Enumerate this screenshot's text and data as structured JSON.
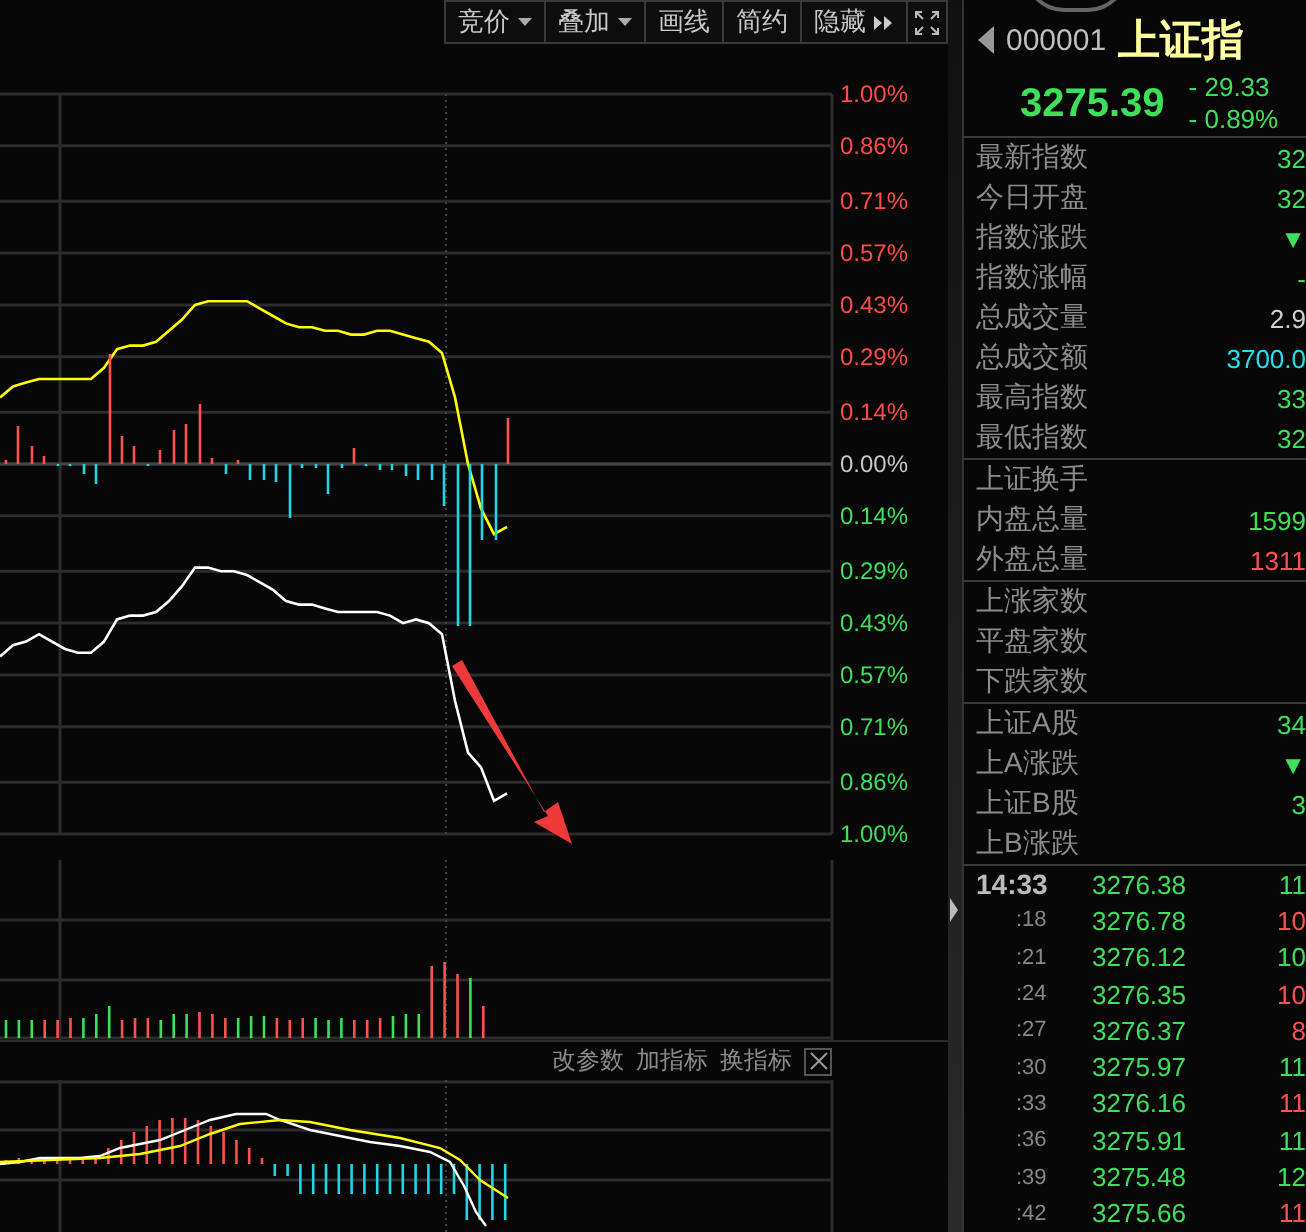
{
  "toolbar": [
    {
      "label": "竞价",
      "kind": "dropdown"
    },
    {
      "label": "叠加",
      "kind": "dropdown"
    },
    {
      "label": "画线",
      "kind": "plain"
    },
    {
      "label": "简约",
      "kind": "plain"
    },
    {
      "label": "隐藏",
      "kind": "expand"
    }
  ],
  "main_chart": {
    "chart_data": {
      "type": "line",
      "grid": true,
      "ylim": [
        -1,
        1
      ],
      "yticks": [
        {
          "value": 1,
          "label": "1.00%"
        },
        {
          "value": 0.86,
          "label": "0.86%"
        },
        {
          "value": 0.71,
          "label": "0.71%"
        },
        {
          "value": 0.57,
          "label": "0.57%"
        },
        {
          "value": 0.43,
          "label": "0.43%"
        },
        {
          "value": 0.29,
          "label": "0.29%"
        },
        {
          "value": 0.14,
          "label": "0.14%"
        },
        {
          "value": 0,
          "label": "0.00%"
        },
        {
          "value": -0.14,
          "label": "0.14%"
        },
        {
          "value": -0.29,
          "label": "0.29%"
        },
        {
          "value": -0.43,
          "label": "0.43%"
        },
        {
          "value": -0.57,
          "label": "0.57%"
        },
        {
          "value": -0.71,
          "label": "0.71%"
        },
        {
          "value": -0.86,
          "label": "0.86%"
        },
        {
          "value": -1,
          "label": "1.00%"
        }
      ],
      "series": [
        {
          "color": "#ffff00",
          "values": [
            0.18,
            0.21,
            0.22,
            0.23,
            0.23,
            0.23,
            0.23,
            0.23,
            0.26,
            0.31,
            0.32,
            0.32,
            0.33,
            0.36,
            0.39,
            0.43,
            0.44,
            0.44,
            0.44,
            0.44,
            0.42,
            0.4,
            0.38,
            0.37,
            0.37,
            0.36,
            0.36,
            0.35,
            0.35,
            0.36,
            0.36,
            0.35,
            0.34,
            0.33,
            0.3,
            0.18,
            0.0,
            -0.12,
            -0.19,
            -0.17
          ]
        },
        {
          "color": "#ffffff",
          "values": [
            -0.52,
            -0.49,
            -0.48,
            -0.46,
            -0.48,
            -0.5,
            -0.51,
            -0.51,
            -0.48,
            -0.42,
            -0.41,
            -0.41,
            -0.4,
            -0.37,
            -0.33,
            -0.28,
            -0.28,
            -0.29,
            -0.29,
            -0.3,
            -0.32,
            -0.34,
            -0.37,
            -0.38,
            -0.38,
            -0.39,
            -0.4,
            -0.4,
            -0.4,
            -0.4,
            -0.41,
            -0.43,
            -0.42,
            -0.43,
            -0.46,
            -0.64,
            -0.78,
            -0.82,
            -0.91,
            -0.89
          ]
        }
      ]
    }
  },
  "indicator_bar": {
    "buttons": [
      "改参数",
      "加指标",
      "换指标"
    ]
  },
  "quote": {
    "code": "000001",
    "name": "上证指",
    "price": "3275.39",
    "change": "- 29.33",
    "change_percent": "- 0.89%"
  },
  "info_groups": [
    [
      {
        "label": "最新指数",
        "value": "32",
        "color": "#3ee05a"
      },
      {
        "label": "今日开盘",
        "value": "32",
        "color": "#3ee05a"
      },
      {
        "label": "指数涨跌",
        "value": "▼",
        "color": "#3ee05a"
      },
      {
        "label": "指数涨幅",
        "value": "-",
        "color": "#3ee05a"
      },
      {
        "label": "总成交量",
        "value": "2.9",
        "color": "#d0d0d0"
      },
      {
        "label": "总成交额",
        "value": "3700.0",
        "color": "#20e0f0"
      },
      {
        "label": "最高指数",
        "value": "33",
        "color": "#3ee05a"
      },
      {
        "label": "最低指数",
        "value": "32",
        "color": "#3ee05a"
      }
    ],
    [
      {
        "label": "上证换手"
      },
      {
        "label": "内盘总量",
        "value": "1599",
        "color": "#3ee05a"
      },
      {
        "label": "外盘总量",
        "value": "1311",
        "color": "#ff5050"
      }
    ],
    [
      {
        "label": "上涨家数"
      },
      {
        "label": "平盘家数"
      },
      {
        "label": "下跌家数"
      }
    ],
    [
      {
        "label": "上证A股",
        "value": "34",
        "color": "#3ee05a"
      },
      {
        "label": "上A涨跌",
        "value": "▼",
        "color": "#3ee05a"
      },
      {
        "label": "上证B股",
        "value": "3",
        "color": "#3ee05a"
      },
      {
        "label": "上B涨跌"
      }
    ]
  ],
  "ticks": [
    {
      "time": "14:33",
      "price": "3276.38",
      "volume": "11",
      "color": "#3ee05a",
      "kind": "full"
    },
    {
      "time": ":18",
      "price": "3276.78",
      "volume": "10",
      "color": "#ff5050",
      "kind": "short"
    },
    {
      "time": ":21",
      "price": "3276.12",
      "volume": "10",
      "color": "#3ee05a",
      "kind": "short"
    },
    {
      "time": ":24",
      "price": "3276.35",
      "volume": "10",
      "color": "#ff5050",
      "kind": "short"
    },
    {
      "time": ":27",
      "price": "3276.37",
      "volume": "8",
      "color": "#ff5050",
      "kind": "short"
    },
    {
      "time": ":30",
      "price": "3275.97",
      "volume": "11",
      "color": "#3ee05a",
      "kind": "short"
    },
    {
      "time": ":33",
      "price": "3276.16",
      "volume": "11",
      "color": "#ff5050",
      "kind": "short"
    },
    {
      "time": ":36",
      "price": "3275.91",
      "volume": "11",
      "color": "#3ee05a",
      "kind": "short"
    },
    {
      "time": ":39",
      "price": "3275.48",
      "volume": "12",
      "color": "#3ee05a",
      "kind": "short"
    },
    {
      "time": ":42",
      "price": "3275.66",
      "volume": "11",
      "color": "#ff5050",
      "kind": "short"
    }
  ]
}
